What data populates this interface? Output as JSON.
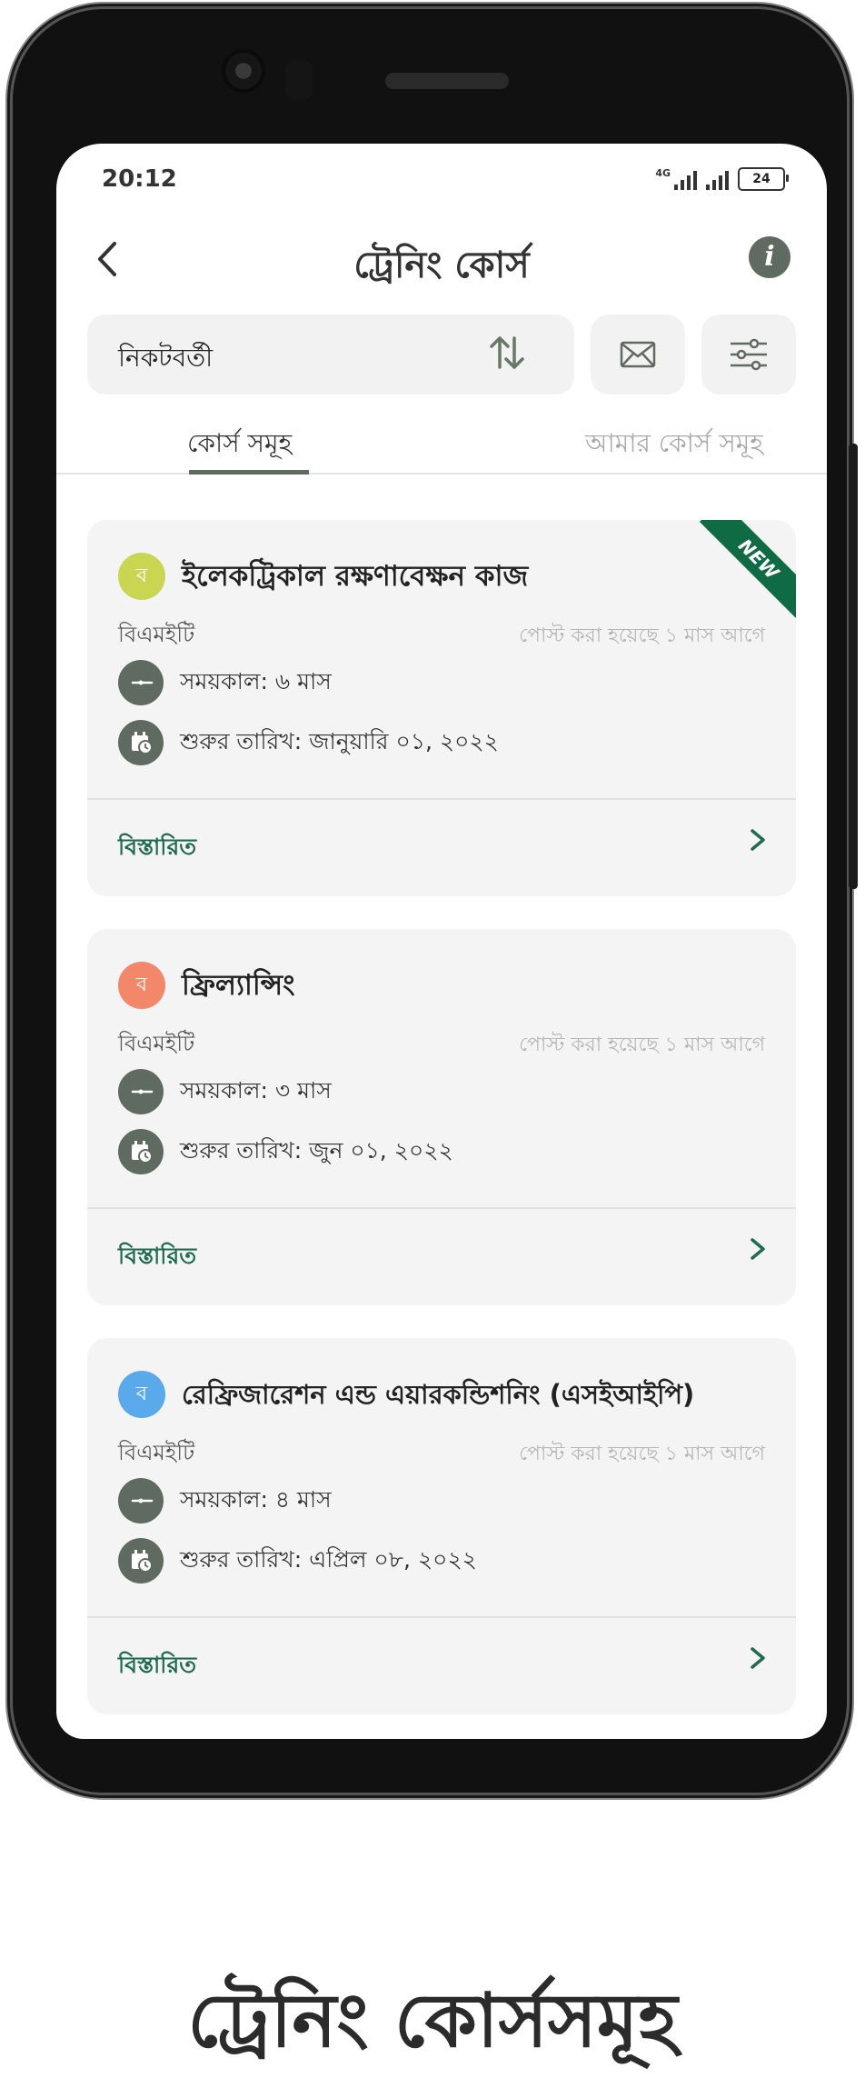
{
  "status_bar": {
    "time": "20:12",
    "network": "4G",
    "battery": "24"
  },
  "header": {
    "title": "ট্রেনিং কোর্স",
    "back_icon": "back-arrow-icon",
    "info_icon": "info-icon"
  },
  "filter": {
    "sort_label": "নিকটবর্তী"
  },
  "tabs": [
    {
      "label": "কোর্স সমূহ",
      "active": true
    },
    {
      "label": "আমার কোর্স সমূহ",
      "active": false
    }
  ],
  "courses": [
    {
      "avatar": "ব",
      "avatar_color": "#c9d652",
      "title": "ইলেকট্রিকাল রক্ষণাবেক্ষন কাজ",
      "org": "বিএমইটি",
      "posted": "পোস্ট করা হয়েছে ১ মাস  আগে",
      "duration": "সময়কাল: ৬ মাস",
      "start_date": "শুরুর তারিখ: জানুয়ারি ০১, ২০২২",
      "details_label": "বিস্তারিত",
      "badge": "NEW"
    },
    {
      "avatar": "ব",
      "avatar_color": "#f3876a",
      "title": "ফ্রিল্যান্সিং",
      "org": "বিএমইটি",
      "posted": "পোস্ট করা হয়েছে ১ মাস  আগে",
      "duration": "সময়কাল: ৩ মাস",
      "start_date": "শুরুর তারিখ: জুন ০১, ২০২২",
      "details_label": "বিস্তারিত",
      "badge": ""
    },
    {
      "avatar": "ব",
      "avatar_color": "#5aa9ea",
      "title": "রেফ্রিজারেশন এন্ড এয়ারকন্ডিশনিং (এসইআইপি)",
      "org": "বিএমইটি",
      "posted": "পোস্ট করা হয়েছে ১ মাস  আগে",
      "duration": "সময়কাল: ৪ মাস",
      "start_date": "শুরুর তারিখ: এপ্রিল ০৮, ২০২২",
      "details_label": "বিস্তারিত",
      "badge": ""
    }
  ],
  "caption": "ট্রেনিং কোর্সসমূহ",
  "colors": {
    "accent": "#1e6b4f",
    "icon_bg": "#5f6b61",
    "card_bg": "#f4f4f4",
    "badge": "#0f6b44"
  }
}
